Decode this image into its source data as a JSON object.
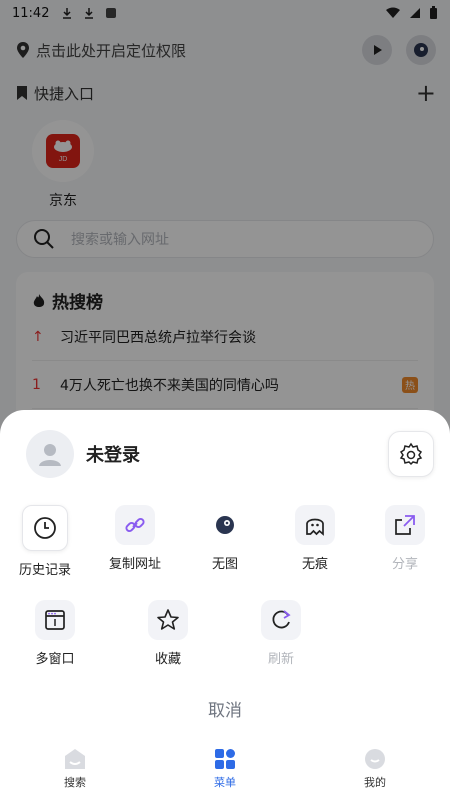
{
  "status": {
    "time": "11:42"
  },
  "header": {
    "location_text": "点击此处开启定位权限"
  },
  "quick": {
    "title": "快捷入口",
    "items": [
      {
        "label": "京东",
        "logo_text": "JD"
      }
    ]
  },
  "search": {
    "placeholder": "搜索或输入网址"
  },
  "hot": {
    "title": "热搜榜",
    "items": [
      {
        "rank": "↑",
        "text": "习近平同巴西总统卢拉举行会谈",
        "badge": ""
      },
      {
        "rank": "1",
        "text": "4万人死亡也换不来美国的同情心吗",
        "badge": "热"
      }
    ]
  },
  "sheet": {
    "user_name": "未登录",
    "menu": [
      {
        "label": "历史记录",
        "icon": "clock-icon"
      },
      {
        "label": "复制网址",
        "icon": "link-icon"
      },
      {
        "label": "无图",
        "icon": "no-image-icon"
      },
      {
        "label": "无痕",
        "icon": "ghost-icon"
      },
      {
        "label": "分享",
        "icon": "share-icon",
        "disabled": true
      },
      {
        "label": "多窗口",
        "icon": "window-icon"
      },
      {
        "label": "收藏",
        "icon": "star-icon"
      },
      {
        "label": "刷新",
        "icon": "refresh-icon",
        "disabled": true
      }
    ],
    "cancel": "取消"
  },
  "nav": {
    "items": [
      {
        "label": "搜索"
      },
      {
        "label": "菜单",
        "active": true
      },
      {
        "label": "我的"
      }
    ]
  },
  "colors": {
    "accent": "#2e6be6",
    "purple": "#8a5cf0",
    "jd_red": "#e1251b"
  }
}
